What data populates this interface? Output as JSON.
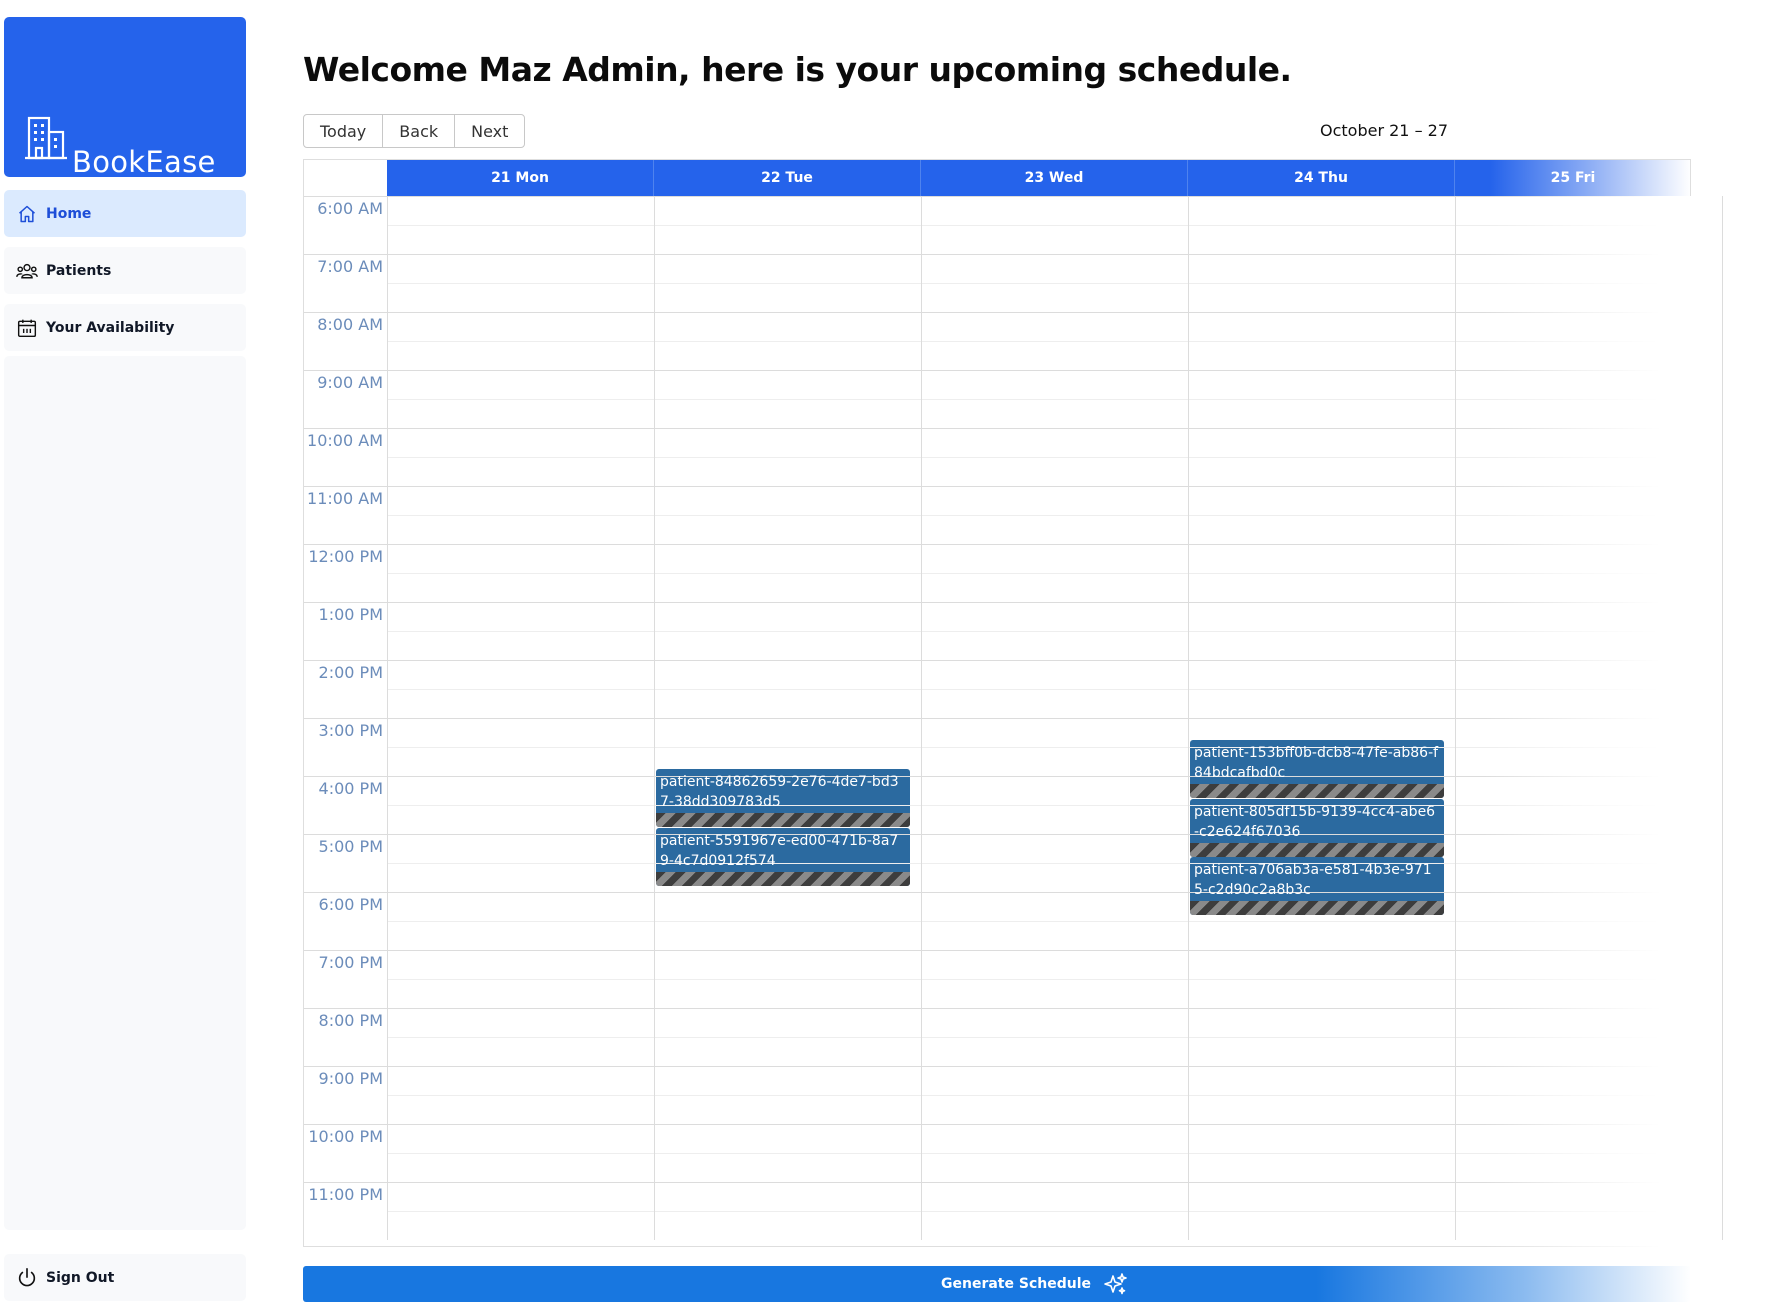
{
  "brand": {
    "name": "BookEase",
    "color": "#2563eb"
  },
  "sidebar": {
    "items": [
      {
        "label": "Home",
        "icon": "home-icon",
        "active": true
      },
      {
        "label": "Patients",
        "icon": "users-icon",
        "active": false
      },
      {
        "label": "Your Availability",
        "icon": "calendar-icon",
        "active": false
      }
    ],
    "sign_out": {
      "label": "Sign Out",
      "icon": "power-icon"
    }
  },
  "main": {
    "title": "Welcome Maz Admin, here is your upcoming schedule.",
    "toolbar": {
      "today": "Today",
      "back": "Back",
      "next": "Next"
    },
    "range": "October 21 – 27",
    "days": [
      "21 Mon",
      "22 Tue",
      "23 Wed",
      "24 Thu",
      "25 Fri"
    ],
    "times": [
      "6:00 AM",
      "7:00 AM",
      "8:00 AM",
      "9:00 AM",
      "10:00 AM",
      "11:00 AM",
      "12:00 PM",
      "1:00 PM",
      "2:00 PM",
      "3:00 PM",
      "4:00 PM",
      "5:00 PM",
      "6:00 PM",
      "7:00 PM",
      "8:00 PM",
      "9:00 PM",
      "10:00 PM",
      "11:00 PM"
    ],
    "events": [
      {
        "day": 1,
        "label": "patient-84862659-2e76-4de7-bd37-38dd309783d5"
      },
      {
        "day": 1,
        "label": "patient-5591967e-ed00-471b-8a79-4c7d0912f574"
      },
      {
        "day": 3,
        "label": "patient-153bff0b-dcb8-47fe-ab86-f84bdcafbd0c"
      },
      {
        "day": 3,
        "label": "patient-805df15b-9139-4cc4-abe6-c2e624f67036"
      },
      {
        "day": 3,
        "label": "patient-a706ab3a-e581-4b3e-9715-c2d90c2a8b3c"
      }
    ],
    "generate_button": {
      "label": "Generate Schedule",
      "icon": "sparkles-icon"
    }
  },
  "colors": {
    "accent": "#2563eb",
    "event": "#2b6aa0",
    "active_nav_bg": "#dbeafe",
    "time_label": "#6b8cba"
  }
}
